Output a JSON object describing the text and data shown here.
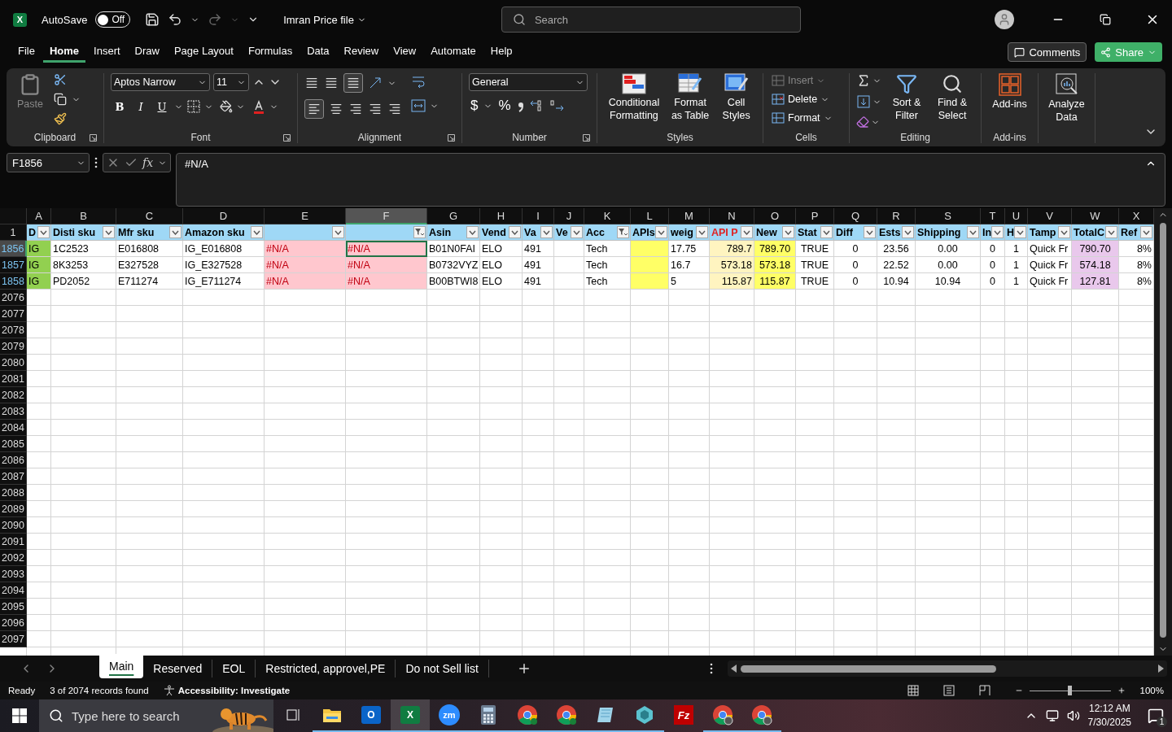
{
  "title_bar": {
    "app_glyph": "X",
    "autosave_label": "AutoSave",
    "autosave": {
      "on": false,
      "label": "Off"
    },
    "file_name": "Imran Price file",
    "search": {
      "placeholder": "Search"
    }
  },
  "menu": {
    "tabs": [
      {
        "label": "File",
        "selected": false
      },
      {
        "label": "Home",
        "selected": true
      },
      {
        "label": "Insert",
        "selected": false
      },
      {
        "label": "Draw",
        "selected": false
      },
      {
        "label": "Page Layout",
        "selected": false
      },
      {
        "label": "Formulas",
        "selected": false
      },
      {
        "label": "Data",
        "selected": false
      },
      {
        "label": "Review",
        "selected": false
      },
      {
        "label": "View",
        "selected": false
      },
      {
        "label": "Automate",
        "selected": false
      },
      {
        "label": "Help",
        "selected": false
      }
    ],
    "comments": "Comments",
    "share": "Share"
  },
  "ribbon": {
    "clipboard": {
      "label": "Clipboard",
      "paste": {
        "label": "Paste",
        "disabled": true
      }
    },
    "font": {
      "label": "Font",
      "family": "Aptos Narrow",
      "size": "11",
      "bold": "B",
      "italic": "I",
      "underline": "U"
    },
    "alignment": {
      "label": "Alignment"
    },
    "number": {
      "label": "Number",
      "format": "General",
      "currency": "$",
      "percent": "%"
    },
    "styles": {
      "label": "Styles",
      "buttons": [
        {
          "label": "Conditional Formatting",
          "kind": "conditional"
        },
        {
          "label": "Format as Table",
          "kind": "table"
        },
        {
          "label": "Cell Styles",
          "kind": "cellstyles"
        }
      ]
    },
    "cells": {
      "label": "Cells",
      "buttons": [
        {
          "label": "Insert",
          "disabled": true,
          "kind": "insert"
        },
        {
          "label": "Delete",
          "disabled": false,
          "kind": "delete"
        },
        {
          "label": "Format",
          "disabled": false,
          "kind": "format"
        }
      ]
    },
    "editing": {
      "label": "Editing",
      "sort": "Sort & Filter",
      "find": "Find & Select"
    },
    "addins": {
      "label": "Add-ins",
      "button": "Add-ins",
      "analyze": "Analyze Data"
    }
  },
  "formula_bar": {
    "name_box": "F1856",
    "fx": "fx",
    "formula": "#N/A"
  },
  "sheet": {
    "columns": [
      {
        "letter": "A",
        "header": "D",
        "selected": false,
        "filtered": false
      },
      {
        "letter": "B",
        "header": "Disti sku",
        "selected": false,
        "filtered": false
      },
      {
        "letter": "C",
        "header": "Mfr sku",
        "selected": false,
        "filtered": false
      },
      {
        "letter": "D",
        "header": "Amazon sku",
        "selected": false,
        "filtered": false
      },
      {
        "letter": "E",
        "selected": false,
        "filtered": false
      },
      {
        "letter": "F",
        "selected": true,
        "filtered": true
      },
      {
        "letter": "G",
        "header": "Asin",
        "selected": false,
        "filtered": false
      },
      {
        "letter": "H",
        "header": "Vend",
        "selected": false,
        "filtered": false
      },
      {
        "letter": "I",
        "header": "Va",
        "selected": false,
        "filtered": false
      },
      {
        "letter": "J",
        "header": "Ve",
        "selected": false,
        "filtered": false
      },
      {
        "letter": "K",
        "header": "Acc",
        "selected": false,
        "filtered": true
      },
      {
        "letter": "L",
        "header": "APIs",
        "selected": false,
        "filtered": false
      },
      {
        "letter": "M",
        "header": "weig",
        "selected": false,
        "filtered": false
      },
      {
        "letter": "N",
        "header": "API P",
        "selected": false,
        "filtered": false
      },
      {
        "letter": "O",
        "header": "New",
        "selected": false,
        "filtered": false
      },
      {
        "letter": "P",
        "header": "Stat",
        "selected": false,
        "filtered": false
      },
      {
        "letter": "Q",
        "header": "Diff",
        "selected": false,
        "filtered": false
      },
      {
        "letter": "R",
        "header": "Ests",
        "selected": false,
        "filtered": false
      },
      {
        "letter": "S",
        "header": "Shipping",
        "selected": false,
        "filtered": false
      },
      {
        "letter": "T",
        "header": "In",
        "selected": false,
        "filtered": false
      },
      {
        "letter": "U",
        "header": "H",
        "selected": false,
        "filtered": false
      },
      {
        "letter": "V",
        "header": "Tamp",
        "selected": false,
        "filtered": false
      },
      {
        "letter": "W",
        "header": "TotalC",
        "selected": false,
        "filtered": false
      },
      {
        "letter": "X",
        "header": "Ref",
        "selected": false,
        "filtered": false
      }
    ],
    "header_row_number": "1",
    "rows": [
      {
        "number": "1856",
        "selected": true,
        "cells": [
          "IG",
          "1C2523",
          "E016808",
          "IG_E016808",
          "#N/A",
          "#N/A",
          "B01N0FAI",
          "ELO",
          "491",
          null,
          "Tech",
          null,
          "17.75",
          "789.7",
          "789.70",
          "TRUE",
          "0",
          "23.56",
          "0.00",
          "0",
          "1",
          "Quick Fr",
          "790.70",
          "8%"
        ]
      },
      {
        "number": "1857",
        "selected": false,
        "cells": [
          "IG",
          "8K3253",
          "E327528",
          "IG_E327528",
          "#N/A",
          "#N/A",
          "B0732VYZ",
          "ELO",
          "491",
          null,
          "Tech",
          null,
          "16.7",
          "573.18",
          "573.18",
          "TRUE",
          "0",
          "22.52",
          "0.00",
          "0",
          "1",
          "Quick Fr",
          "574.18",
          "8%"
        ]
      },
      {
        "number": "1858",
        "selected": false,
        "cells": [
          "IG",
          "PD2052",
          "E711274",
          "IG_E711274",
          "#N/A",
          "#N/A",
          "B00BTWI8",
          "ELO",
          "491",
          null,
          "Tech",
          null,
          "5",
          "115.87",
          "115.87",
          "TRUE",
          "0",
          "10.94",
          "10.94",
          "0",
          "1",
          "Quick Fr",
          "127.81",
          "8%"
        ]
      }
    ],
    "empty_rows": [
      "2076",
      "2077",
      "2078",
      "2079",
      "2080",
      "2081",
      "2082",
      "2083",
      "2084",
      "2085",
      "2086",
      "2087",
      "2088",
      "2089",
      "2090",
      "2091",
      "2092",
      "2093",
      "2094",
      "2095",
      "2096",
      "2097"
    ]
  },
  "sheet_tabs": [
    {
      "label": "Main",
      "selected": true
    },
    {
      "label": "Reserved",
      "selected": false
    },
    {
      "label": "EOL",
      "selected": false
    },
    {
      "label": "Restricted, approvel,PE",
      "selected": false
    },
    {
      "label": "Do not Sell list",
      "selected": false
    }
  ],
  "status_bar": {
    "ready": "Ready",
    "records": "3 of 2074 records found",
    "accessibility": "Accessibility: Investigate",
    "zoom": {
      "level": 0.5
    },
    "zoom_label": "100%"
  },
  "taskbar": {
    "search": {
      "placeholder": "Type here to search"
    },
    "apps": [
      {
        "kind": "folder",
        "running": true,
        "selected": false
      },
      {
        "kind": "outlook",
        "glyph": "O",
        "running": true,
        "selected": false
      },
      {
        "kind": "excel",
        "glyph": "X",
        "running": true,
        "selected": true
      },
      {
        "kind": "zoom",
        "glyph": "zm",
        "running": true,
        "selected": false
      },
      {
        "kind": "calculator",
        "running": true,
        "selected": false
      },
      {
        "kind": "chrome",
        "running": true,
        "selected": false
      },
      {
        "kind": "chrome",
        "running": true,
        "selected": false
      },
      {
        "kind": "notepad",
        "running": true,
        "selected": false
      },
      {
        "kind": "gem",
        "running": true,
        "selected": false
      },
      {
        "kind": "filezilla",
        "glyph": "Fz",
        "running": false,
        "selected": false
      },
      {
        "kind": "chrome-profile",
        "running": true,
        "selected": false
      },
      {
        "kind": "chrome-profile",
        "running": true,
        "selected": false
      }
    ],
    "time": "12:12 AM",
    "date": "7/30/2025",
    "notifications": "1"
  }
}
